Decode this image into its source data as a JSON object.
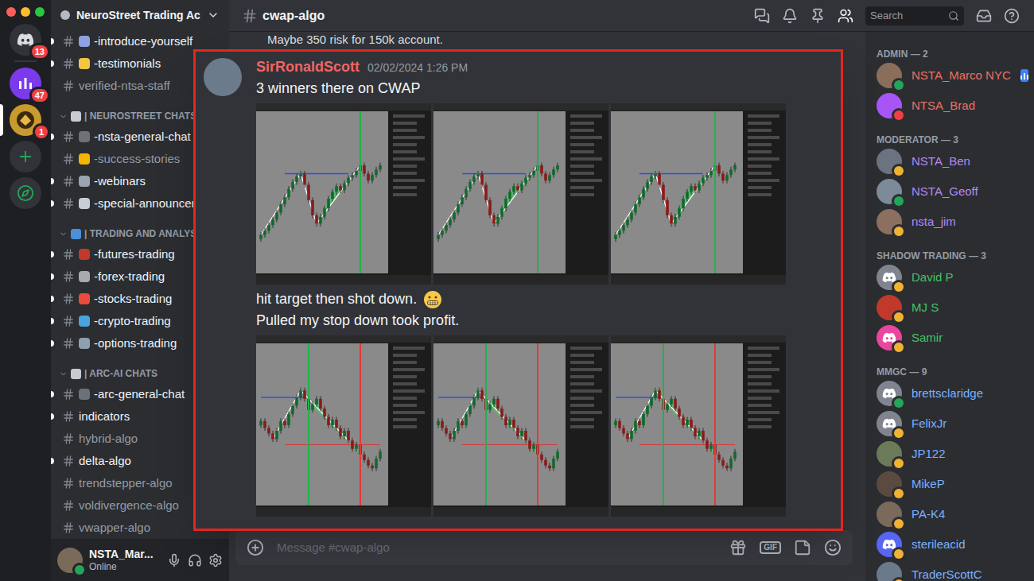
{
  "rail": {
    "items": [
      {
        "kind": "home",
        "badge": "13",
        "selected": false,
        "color": "#313338"
      },
      {
        "kind": "server",
        "badge": "47",
        "selected": false,
        "color": "#7c3aed"
      },
      {
        "kind": "server",
        "badge": "1",
        "selected": true,
        "color": "#c99a2e"
      },
      {
        "kind": "add",
        "badge": "",
        "selected": false,
        "color": "#313338"
      },
      {
        "kind": "explore",
        "badge": "",
        "selected": false,
        "color": "#313338"
      }
    ]
  },
  "server": {
    "name": "NeuroStreet Trading Ac"
  },
  "channels": [
    {
      "kind": "channel",
      "name": "-introduce-yourself",
      "unread": true,
      "color": "#8ea1e1"
    },
    {
      "kind": "channel",
      "name": "-testimonials",
      "unread": true,
      "color": "#f5c542"
    },
    {
      "kind": "channel",
      "name": "verified-ntsa-staff",
      "unread": false,
      "color": ""
    },
    {
      "kind": "category",
      "name": "| NEUROSTREET CHATS",
      "expanded": true,
      "color": "#c7ccd1"
    },
    {
      "kind": "channel",
      "name": "-nsta-general-chat",
      "unread": true,
      "color": "#6d7178"
    },
    {
      "kind": "channel",
      "name": "-success-stories",
      "unread": false,
      "color": "#f5b400"
    },
    {
      "kind": "channel",
      "name": "-webinars",
      "unread": true,
      "color": "#9aa5b1"
    },
    {
      "kind": "channel",
      "name": "-special-announcem",
      "unread": true,
      "color": "#c9ced6"
    },
    {
      "kind": "category",
      "name": "| TRADING AND ANALYSIS",
      "expanded": true,
      "color": "#4a90d9"
    },
    {
      "kind": "channel",
      "name": "-futures-trading",
      "unread": true,
      "color": "#c0392b"
    },
    {
      "kind": "channel",
      "name": "-forex-trading",
      "unread": true,
      "color": "#a7a9ac"
    },
    {
      "kind": "channel",
      "name": "-stocks-trading",
      "unread": true,
      "color": "#e74c3c"
    },
    {
      "kind": "channel",
      "name": "-crypto-trading",
      "unread": true,
      "color": "#4aa3df"
    },
    {
      "kind": "channel",
      "name": "-options-trading",
      "unread": true,
      "color": "#8e9fb1"
    },
    {
      "kind": "category",
      "name": "| ARC-AI CHATS",
      "expanded": true,
      "color": "#c7ccd1"
    },
    {
      "kind": "channel",
      "name": "-arc-general-chat",
      "unread": true,
      "color": "#6d7178"
    },
    {
      "kind": "channel",
      "name": "indicators",
      "unread": true,
      "color": ""
    },
    {
      "kind": "channel",
      "name": "hybrid-algo",
      "unread": false,
      "color": ""
    },
    {
      "kind": "channel",
      "name": "delta-algo",
      "unread": true,
      "color": ""
    },
    {
      "kind": "channel",
      "name": "trendstepper-algo",
      "unread": false,
      "color": ""
    },
    {
      "kind": "channel",
      "name": "voldivergence-algo",
      "unread": false,
      "color": ""
    },
    {
      "kind": "channel",
      "name": "vwapper-algo",
      "unread": false,
      "color": ""
    }
  ],
  "user": {
    "name": "NSTA_Mar...",
    "status": "Online"
  },
  "header": {
    "channel": "cwap-algo",
    "search_placeholder": "Search"
  },
  "chat": {
    "previous_message": "Maybe 350 risk for 150k account.",
    "input_placeholder": "Message #cwap-algo",
    "gif": "GIF"
  },
  "members": [
    {
      "title": "ADMIN — 2",
      "color": "#ef6f63",
      "members": [
        {
          "name": "NSTA_Marco NYC",
          "status": "online",
          "avatar": "photo",
          "avatar_color": "#8a6d5a",
          "badge": true
        },
        {
          "name": "NTSA_Brad",
          "status": "dnd",
          "avatar": "photo",
          "avatar_color": "#a855f7",
          "badge": false
        }
      ]
    },
    {
      "title": "MODERATOR — 3",
      "color": "#b689f0",
      "members": [
        {
          "name": "NSTA_Ben",
          "status": "idle",
          "avatar": "photo",
          "avatar_color": "#6b7280",
          "badge": false
        },
        {
          "name": "NSTA_Geoff",
          "status": "online",
          "avatar": "photo",
          "avatar_color": "#7c8a99",
          "badge": false
        },
        {
          "name": "nsta_jim",
          "status": "idle",
          "avatar": "photo",
          "avatar_color": "#8b6f60",
          "badge": false
        }
      ]
    },
    {
      "title": "SHADOW TRADING — 3",
      "color": "#43c463",
      "members": [
        {
          "name": "David P",
          "status": "idle",
          "avatar": "default",
          "avatar_color": "#80848e",
          "badge": false
        },
        {
          "name": "MJ S",
          "status": "idle",
          "avatar": "photo",
          "avatar_color": "#c0392b",
          "badge": false
        },
        {
          "name": "Samir",
          "status": "idle",
          "avatar": "default",
          "avatar_color": "#eb459e",
          "badge": false
        }
      ]
    },
    {
      "title": "MMGC — 9",
      "color": "#7ab0ff",
      "members": [
        {
          "name": "brettsclaridge",
          "status": "online",
          "avatar": "default",
          "avatar_color": "#80848e",
          "badge": false
        },
        {
          "name": "FelixJr",
          "status": "idle",
          "avatar": "default",
          "avatar_color": "#80848e",
          "badge": false
        },
        {
          "name": "JP122",
          "status": "idle",
          "avatar": "photo",
          "avatar_color": "#6b7b5a",
          "badge": false
        },
        {
          "name": "MikeP",
          "status": "idle",
          "avatar": "photo",
          "avatar_color": "#5a4a40",
          "badge": false
        },
        {
          "name": "PA-K4",
          "status": "idle",
          "avatar": "photo",
          "avatar_color": "#7a6a5a",
          "badge": false
        },
        {
          "name": "sterileacid",
          "status": "idle",
          "avatar": "default",
          "avatar_color": "#5865f2",
          "badge": false
        },
        {
          "name": "TraderScottC",
          "status": "idle",
          "avatar": "photo",
          "avatar_color": "#6a7a8a",
          "badge": false
        }
      ]
    }
  ],
  "highlight": {
    "author": "SirRonaldScott",
    "author_color": "#f06565",
    "timestamp": "02/02/2024 1:26 PM",
    "avatar_color": "#6b7b8c",
    "blocks": [
      {
        "kind": "text",
        "text": "3 winners there on CWAP"
      },
      {
        "kind": "charts",
        "charts": [
          {
            "values": [
              22,
              25,
              29,
              33,
              38,
              44,
              49,
              55,
              60,
              64,
              66,
              58,
              47,
              36,
              30,
              35,
              41,
              48,
              53,
              57,
              54,
              59,
              63,
              65,
              68,
              72,
              66,
              61,
              65,
              69,
              72
            ],
            "target": {
              "value": 66,
              "from": 6,
              "to": 22
            },
            "pattern": [
              0,
              10,
              14,
              25
            ],
            "zone": [
              14,
              25
            ],
            "markers": [
              {
                "index": 25,
                "color": "#22b14c"
              }
            ]
          },
          {
            "values": [
              22,
              25,
              29,
              33,
              38,
              44,
              49,
              55,
              60,
              64,
              66,
              58,
              47,
              36,
              30,
              35,
              41,
              48,
              53,
              57,
              54,
              59,
              63,
              65,
              68,
              72,
              66,
              61,
              65,
              69,
              72
            ],
            "target": {
              "value": 66,
              "from": 6,
              "to": 22
            },
            "pattern": [
              0,
              10,
              14,
              25
            ],
            "zone": [
              14,
              25
            ],
            "markers": [
              {
                "index": 25,
                "color": "#22b14c"
              }
            ]
          },
          {
            "values": [
              22,
              25,
              29,
              33,
              38,
              44,
              49,
              55,
              60,
              64,
              66,
              58,
              47,
              36,
              30,
              35,
              41,
              48,
              53,
              57,
              54,
              59,
              63,
              65,
              68,
              72,
              66,
              61,
              65,
              69,
              72
            ],
            "target": {
              "value": 66,
              "from": 6,
              "to": 22
            },
            "pattern": [
              0,
              10,
              14,
              25
            ],
            "zone": [
              14,
              25
            ],
            "markers": [
              {
                "index": 25,
                "color": "#22b14c"
              }
            ]
          }
        ]
      },
      {
        "kind": "text_emoji",
        "text": "hit target then shot down."
      },
      {
        "kind": "text",
        "text": "Pulled my stop down took profit."
      },
      {
        "kind": "charts",
        "charts": [
          {
            "values": [
              55,
              50,
              46,
              42,
              48,
              55,
              52,
              60,
              66,
              72,
              77,
              71,
              63,
              67,
              71,
              64,
              58,
              52,
              56,
              50,
              44,
              48,
              41,
              35,
              38,
              31,
              27,
              23,
              21,
              28,
              33
            ],
            "target": {
              "value": 72,
              "from": 0,
              "to": 12
            },
            "stop": {
              "value": 38,
              "from": 6,
              "to": 30
            },
            "pattern": [
              3,
              10,
              22
            ],
            "zone": [
              11,
              25
            ],
            "markers": [
              {
                "index": 12,
                "color": "#22b14c"
              },
              {
                "index": 25,
                "color": "#e53935"
              }
            ]
          },
          {
            "values": [
              55,
              50,
              46,
              42,
              48,
              55,
              52,
              60,
              66,
              72,
              77,
              71,
              63,
              67,
              71,
              64,
              58,
              52,
              56,
              50,
              44,
              48,
              41,
              35,
              38,
              31,
              27,
              23,
              21,
              28,
              33
            ],
            "target": {
              "value": 72,
              "from": 0,
              "to": 12
            },
            "stop": {
              "value": 38,
              "from": 6,
              "to": 30
            },
            "pattern": [
              3,
              10,
              22
            ],
            "zone": [
              11,
              25
            ],
            "markers": [
              {
                "index": 12,
                "color": "#22b14c"
              },
              {
                "index": 25,
                "color": "#e53935"
              }
            ]
          },
          {
            "values": [
              55,
              50,
              46,
              42,
              48,
              55,
              52,
              60,
              66,
              72,
              77,
              71,
              63,
              67,
              71,
              64,
              58,
              52,
              56,
              50,
              44,
              48,
              41,
              35,
              38,
              31,
              27,
              23,
              21,
              28,
              33
            ],
            "target": {
              "value": 72,
              "from": 0,
              "to": 12
            },
            "stop": {
              "value": 38,
              "from": 6,
              "to": 30
            },
            "pattern": [
              3,
              10,
              22
            ],
            "zone": [
              11,
              25
            ],
            "markers": [
              {
                "index": 12,
                "color": "#22b14c"
              },
              {
                "index": 25,
                "color": "#e53935"
              }
            ]
          }
        ]
      }
    ]
  }
}
